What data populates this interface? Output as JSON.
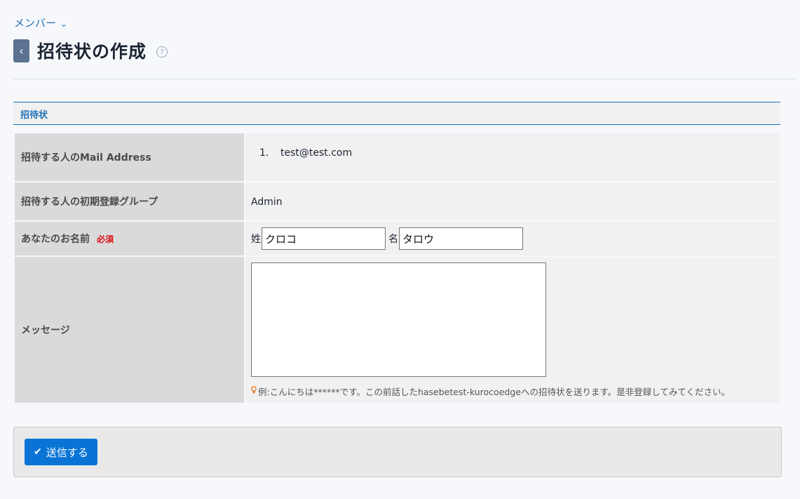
{
  "breadcrumb": {
    "label": "メンバー",
    "chevron": "⌄"
  },
  "header": {
    "back_icon": "‹",
    "title": "招待状の作成",
    "help_icon": "?"
  },
  "section": {
    "title": "招待状"
  },
  "form": {
    "email": {
      "label": "招待する人のMail Address",
      "items": [
        {
          "num": "1.",
          "value": "test@test.com"
        }
      ]
    },
    "group": {
      "label": "招待する人の初期登録グループ",
      "value": "Admin"
    },
    "name": {
      "label": "あなたのお名前",
      "required": "必須",
      "last_caption": "姓",
      "last_value": "クロコ",
      "first_caption": "名",
      "first_value": "タロウ"
    },
    "message": {
      "label": "メッセージ",
      "value": "",
      "hint": "例:こんにちは******です。この前話したhasebetest-kurocoedgeへの招待状を送ります。是非登録してみてください。"
    }
  },
  "footer": {
    "submit_label": "送信する",
    "submit_icon": "✔"
  },
  "colors": {
    "accent": "#1f6fb5",
    "button": "#0a74d6",
    "required": "#e0101a"
  }
}
